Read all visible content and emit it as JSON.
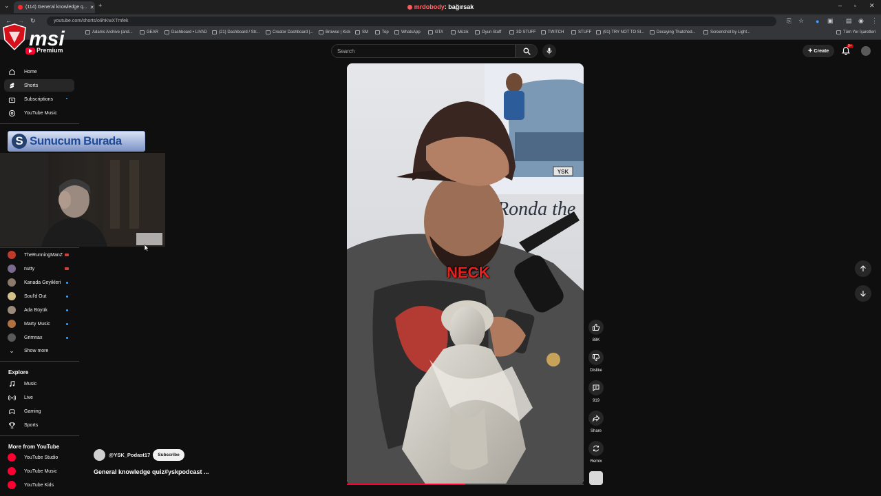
{
  "browser": {
    "tab_title": "(114) General knowledge q...",
    "url": "youtube.com/shorts/o9hKwXTmfek",
    "window_title_user": "mrdobody",
    "window_title_text": ": bağırsak",
    "bookmarks": [
      "Adams Archive (and...",
      "GEAR",
      "Dashboard • LIVAD",
      "(21) Dashboard / Str...",
      "Creator Dashboard |...",
      "Browse | Kick",
      "SM",
      "Top",
      "WhatsApp",
      "GTA",
      "Müzik",
      "Oyun Stuff",
      "3D STUFF",
      "TWITCH",
      "STUFF",
      "(91) TRY NOT TO SI...",
      "Decaying Thatched...",
      "Screenshot by Light...",
      "Tüm Yer İşaretleri"
    ]
  },
  "overlay": {
    "msi_logo": "msi",
    "sunucum_text": "Sunucum Burada",
    "sunucum_letter": "S"
  },
  "header": {
    "logo_text": "Premium",
    "search_placeholder": "Search",
    "create_label": "Create",
    "notif_badge": "9+"
  },
  "sidebar": {
    "main": [
      {
        "label": "Home",
        "icon": "home-icon"
      },
      {
        "label": "Shorts",
        "icon": "shorts-icon"
      },
      {
        "label": "Subscriptions",
        "icon": "subscriptions-icon"
      },
      {
        "label": "YouTube Music",
        "icon": "music-disc-icon"
      }
    ],
    "channels": [
      {
        "name": "TheRunningManZ",
        "live": true,
        "color": "#c0392b"
      },
      {
        "name": "nutty",
        "live": true,
        "color": "#7b6a8f"
      },
      {
        "name": "Kanada Geyikleri",
        "live": false,
        "color": "#8a7a6a"
      },
      {
        "name": "Soul'd Out",
        "live": false,
        "color": "#d4c08a"
      },
      {
        "name": "Ada Büyük",
        "live": false,
        "color": "#9a8a7a"
      },
      {
        "name": "Marty Music",
        "live": false,
        "color": "#b07040"
      },
      {
        "name": "Grimnax",
        "live": false,
        "color": "#5a5a5a"
      }
    ],
    "show_more": "Show more",
    "explore_title": "Explore",
    "explore": [
      {
        "label": "Music",
        "icon": "music-note-icon"
      },
      {
        "label": "Live",
        "icon": "live-icon"
      },
      {
        "label": "Gaming",
        "icon": "gaming-icon"
      },
      {
        "label": "Sports",
        "icon": "trophy-icon"
      }
    ],
    "more_title": "More from YouTube",
    "more": [
      {
        "label": "YouTube Studio"
      },
      {
        "label": "YouTube Music"
      },
      {
        "label": "YouTube Kids"
      }
    ]
  },
  "video": {
    "caption": "NECK",
    "plate_text": "YSK",
    "bg_text": "Ronda the",
    "channel": "@YSK_Podast17",
    "subscribe": "Subscribe",
    "title": "General knowledge quiz#yskpodcast ...",
    "progress": 0.5
  },
  "actions": {
    "likes": "88K",
    "dislike": "Dislike",
    "comments": "919",
    "share": "Share",
    "remix": "Remix"
  }
}
